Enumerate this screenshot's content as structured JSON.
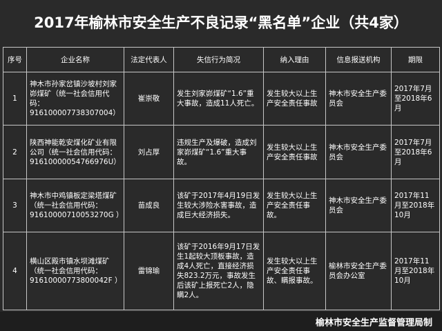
{
  "title": "2017年榆林市安全生产不良记录“黑名单”企业（共4家）",
  "table": {
    "headers": [
      "序号",
      "企业名称",
      "法定代表人",
      "失信行为简况",
      "纳入理由",
      "信息报送机构",
      "期限"
    ],
    "rows": [
      {
        "no": "1",
        "company": "神木市孙家岔镇沙坡村刘家峁煤矿（统一社会信用代码：916100007738307004）",
        "rep": "崔崇敬",
        "behavior": "发生刘家峁煤矿“1.6”重大事故，造成11人死亡。",
        "reason": "发生较大以上生产安全责任事故",
        "agency": "神木市安全生产委员会",
        "period": "2017年7月至2018年6月"
      },
      {
        "no": "2",
        "company": "陕西神能乾安煤化矿业有限公司（统一社会信用代码：91610000054766976U）",
        "rep": "刘占厚",
        "behavior": "违规生产及爆破，造成刘家峁煤矿“1.6”重大事故。",
        "reason": "发生较大以上生产安全责任事故",
        "agency": "神木市安全生产委员会",
        "period": "2017年7月至2018年6月"
      },
      {
        "no": "3",
        "company": "神木市中鸡镇板定梁塔煤矿（统一社会信用代码：91610000710053270G ）",
        "rep": "苗成良",
        "behavior": "该矿于2017年4月19日发生较大涉险水害事故，造成巨大经济损失。",
        "reason": "发生较大以上生产安全责任事故。",
        "agency": "神木市安全生产委员会",
        "period": "2017年11月至2018年10月"
      },
      {
        "no": "4",
        "company": "横山区殿市镇水坝滩煤矿（统一社会信用代码：91610000773800042F ）",
        "rep": "雷锦瑜",
        "behavior": "该矿于2016年9月17日发生1起较大顶板事故，造成4人死亡，直接经济损失823.2万元，事故发生后该矿上报死亡2人，隐瞒2人。",
        "reason": "发生较大以上生产安全责任事故、瞒报事故。",
        "agency": "榆林市安全生产委员会办公室",
        "period": "2017年11月至2018年10月"
      }
    ]
  },
  "footer": "榆林市安全生产监督管理局制"
}
